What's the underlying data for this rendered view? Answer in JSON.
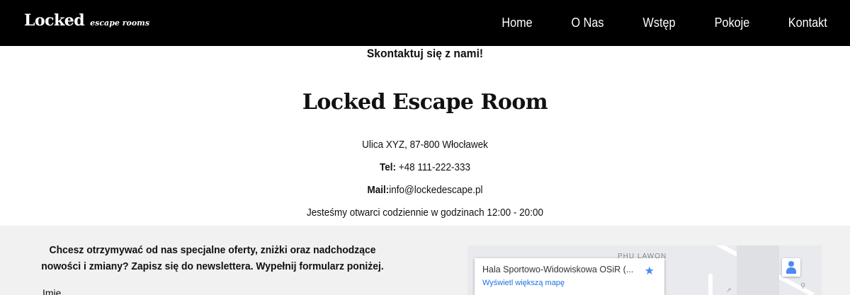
{
  "header": {
    "logo_main": "Locked",
    "logo_sub": "escape rooms",
    "nav": [
      "Home",
      "O Nas",
      "Wstęp",
      "Pokoje",
      "Kontakt"
    ]
  },
  "contact": {
    "heading": "Skontaktuj się z nami!",
    "brand_title": "Locked Escape Room",
    "address": "Ulica XYZ, 87-800 Włocławek",
    "tel_label": "Tel:",
    "tel_value": " +48 111-222-333",
    "mail_label": "Mail:",
    "mail_value": "info@lockedescape.pl",
    "hours": "Jesteśmy otwarci codziennie w godzinach 12:00 - 20:00"
  },
  "newsletter": {
    "text": "Chcesz otrzymywać od nas specjalne oferty, zniżki oraz nadchodzące nowości i zmiany? Zapisz się do newslettera. Wypełnij formularz poniżej.",
    "name_label": "Imię"
  },
  "map": {
    "place_title": "Hala Sportowo-Widowiskowa OSiR (...",
    "view_larger": "Wyświetl większą mapę",
    "map_label": "PHU LAWON",
    "star_icon": "star-icon",
    "pegman_icon": "pegman-icon",
    "accent": "#4a8af4",
    "link_color": "#1a73e8"
  }
}
